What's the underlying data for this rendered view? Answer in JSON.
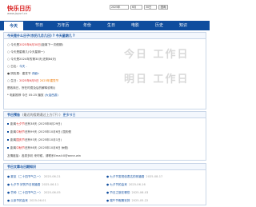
{
  "header": {
    "logo": "快乐日历",
    "url": "www.joyurl.cn",
    "year": "2025年",
    "month": "6月",
    "day": "30日",
    "query": "查询"
  },
  "nav": [
    "今天",
    "节日",
    "万年历",
    "年份",
    "生日",
    "电影",
    "历史",
    "知识"
  ],
  "today": {
    "title": "今天是什么日子(农历几月几日) ? 今天星期几 ?",
    "lines": [
      {
        "pre": "○ 今天是",
        "hl": "2025年6月30日",
        "post": "(距离下一次假期)"
      },
      {
        "pre": "○ 今天是星期几(今天星期一)",
        "hl": "",
        "post": ""
      },
      {
        "pre": "○ 今天是2024年的第30天(还剩84天)",
        "hl": "",
        "post": ""
      },
      {
        "pre": "○ 日出：",
        "hl": "今天 -",
        "post": ""
      },
      {
        "pre": "● 阴历是：建党节",
        "hl": "",
        "post": "详细»"
      },
      {
        "pre": "○ 生日：",
        "hl": "2025年6月5日",
        "post": "2025年建党节"
      },
      {
        "pre": "是政商日，所在时费及后的解释说明(",
        "hl": "",
        "post": ")"
      },
      {
        "pre": "* 电影推荐 今日 05:25 播放 ",
        "hl": "",
        "post": "(大话西游)"
      }
    ],
    "big1": "今日 工作日",
    "big2": "明日 工作日"
  },
  "holidays": {
    "title": "节日预告",
    "sub": "(最近的假期通过上方(下) )",
    "more": "更多节日",
    "rows": [
      {
        "pre": "距离",
        "hl": "七夕节",
        "post": "还有38天 (2025年8月29日)"
      },
      {
        "pre": "距离",
        "hl": "中秋节",
        "post": "还有99天 (2025年10月6日) 国庆假"
      },
      {
        "pre": "距离",
        "hl": "国庆节",
        "post": "还有93天 (2025年10月1日)"
      },
      {
        "pre": "距离",
        "hl": "中秋节",
        "post": "还有98天 (2025年10月6日 休假)"
      },
      {
        "pre": "友情链接：",
        "hl": "",
        "post": "各类多彩 来时候，请联系Email:0@anne.win"
      }
    ]
  },
  "articles": {
    "title": "节日文章与日期知识",
    "rows": [
      {
        "l": "夏至（二十四节气之一）",
        "ld": "2025-06-21",
        "r": "七夕节发短信表达的祝福语",
        "rd": "2025-08-17"
      },
      {
        "l": "七夕节 好的节日祝福语",
        "ld": "2025-06-11",
        "r": "七夕节的由来",
        "rd": "2025-06-16"
      },
      {
        "l": "芒种（二十四节气之一）",
        "ld": "2025-06-05",
        "r": "节日之旅在哪些",
        "rd": "2025-06-03"
      },
      {
        "l": "父亲节的由来",
        "ld": "2025-06-01",
        "r": "端午节假期安排",
        "rd": "2025-05-22"
      }
    ]
  }
}
